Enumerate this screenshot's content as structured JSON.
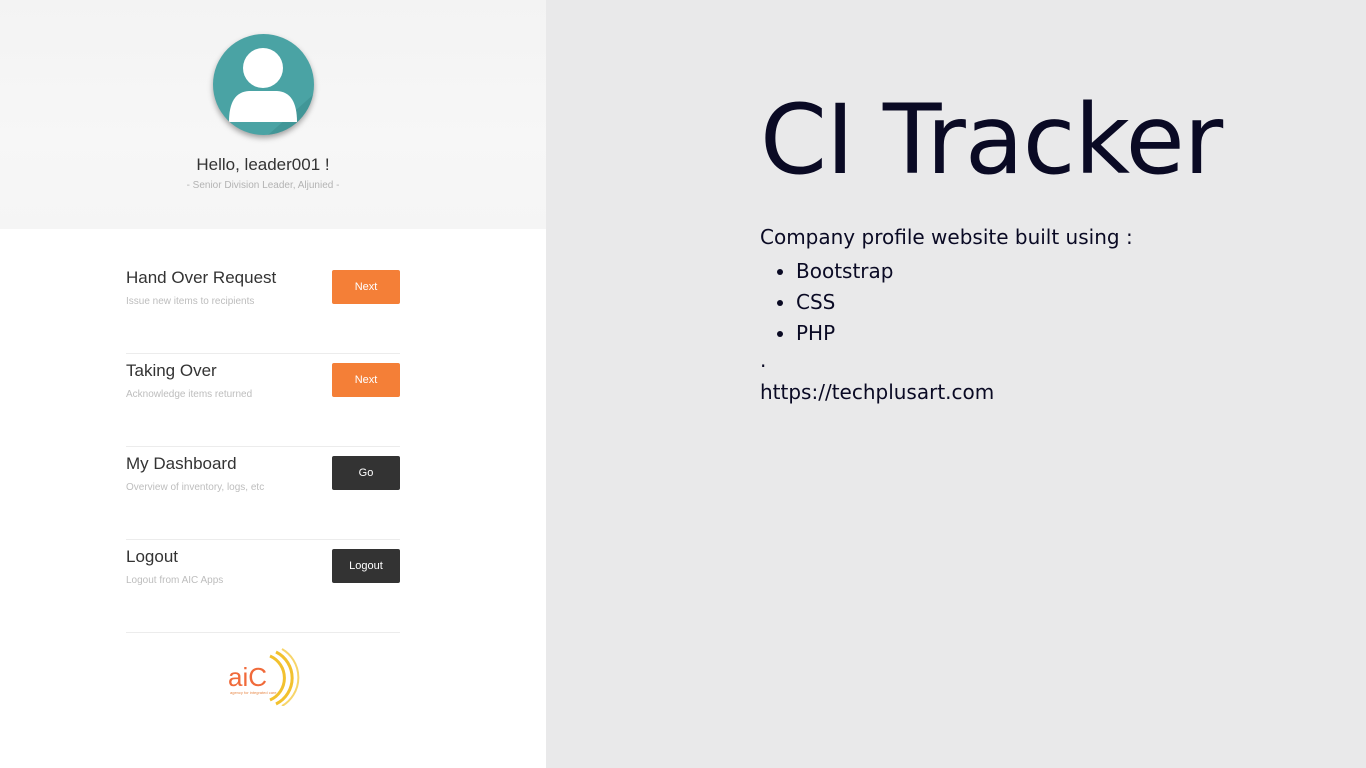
{
  "profile": {
    "greeting": "Hello, leader001 !",
    "role": "- Senior Division Leader, Aljunied -",
    "avatar_icon": "user-icon",
    "avatar_color": "#4aa3a4"
  },
  "menu": [
    {
      "title": "Hand Over Request",
      "subtitle": "Issue new items to recipients",
      "button": "Next",
      "button_color": "#f47f37"
    },
    {
      "title": "Taking Over",
      "subtitle": "Acknowledge items returned",
      "button": "Next",
      "button_color": "#f47f37"
    },
    {
      "title": "My Dashboard",
      "subtitle": "Overview of inventory, logs, etc",
      "button": "Go",
      "button_color": "#333333"
    },
    {
      "title": "Logout",
      "subtitle": "Logout from AIC Apps",
      "button": "Logout",
      "button_color": "#333333"
    }
  ],
  "logo": {
    "text": "aiC",
    "tagline": "agency for integrated care",
    "icon": "aic-logo"
  },
  "showcase": {
    "title": "CI Tracker",
    "intro": "Company profile website built using :",
    "technologies": [
      "Bootstrap",
      "CSS",
      "PHP"
    ],
    "separator": ".",
    "url": "https://techplusart.com"
  }
}
